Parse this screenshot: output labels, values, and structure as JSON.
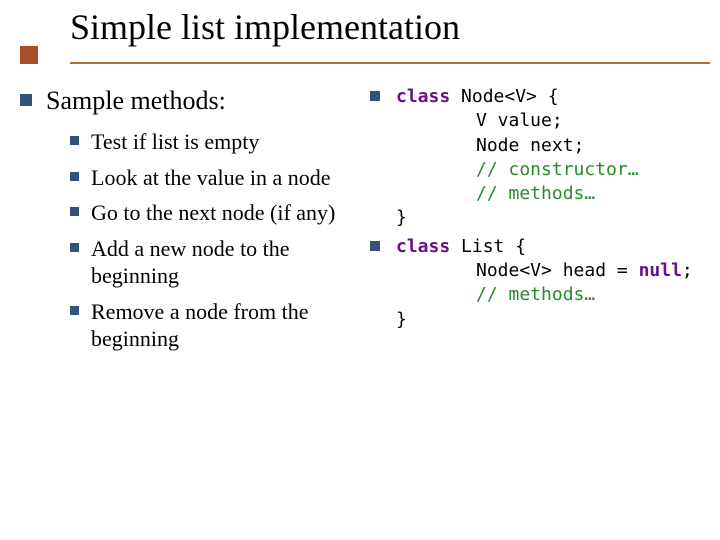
{
  "title": "Simple list implementation",
  "left": {
    "heading": "Sample methods:",
    "items": [
      "Test if list is empty",
      "Look at the value in a node",
      "Go to the next node (if any)",
      "Add a new node to the beginning",
      "Remove a node from the beginning"
    ]
  },
  "right": {
    "snippets": [
      {
        "segments": [
          {
            "cls": "kw",
            "t": "class"
          },
          {
            "cls": "plain",
            "t": " Node<V> {"
          },
          {
            "cls": "br"
          },
          {
            "cls": "indent"
          },
          {
            "cls": "plain",
            "t": "V value;"
          },
          {
            "cls": "br"
          },
          {
            "cls": "indent"
          },
          {
            "cls": "plain",
            "t": "Node next;"
          },
          {
            "cls": "br"
          },
          {
            "cls": "indent"
          },
          {
            "cls": "cmt",
            "t": "// constructor…"
          },
          {
            "cls": "br"
          },
          {
            "cls": "indent"
          },
          {
            "cls": "cmt",
            "t": "// methods…"
          },
          {
            "cls": "br"
          },
          {
            "cls": "plain",
            "t": "}"
          }
        ]
      },
      {
        "segments": [
          {
            "cls": "kw",
            "t": "class"
          },
          {
            "cls": "plain",
            "t": " List {"
          },
          {
            "cls": "br"
          },
          {
            "cls": "indent"
          },
          {
            "cls": "plain",
            "t": "Node<V> head = "
          },
          {
            "cls": "kw",
            "t": "null"
          },
          {
            "cls": "plain",
            "t": ";"
          },
          {
            "cls": "br"
          },
          {
            "cls": "indent"
          },
          {
            "cls": "cmt",
            "t": "// methods…"
          },
          {
            "cls": "br"
          },
          {
            "cls": "plain",
            "t": "}"
          }
        ]
      }
    ]
  }
}
